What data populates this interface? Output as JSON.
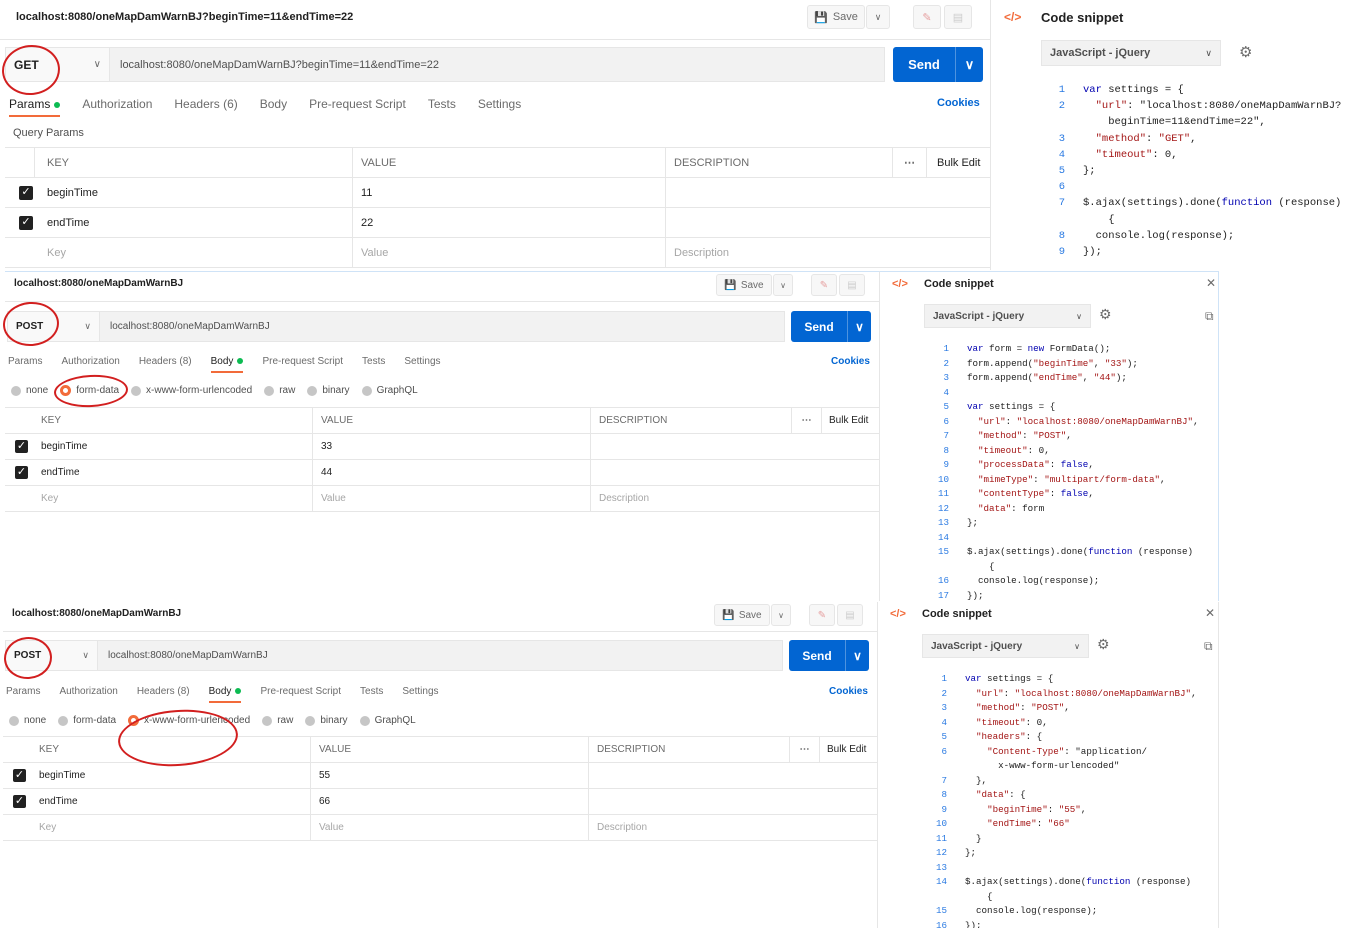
{
  "common": {
    "save_label": "Save",
    "send_label": "Send",
    "cookies_label": "Cookies",
    "bulk_edit_label": "Bulk Edit",
    "code_snippet_title": "Code snippet",
    "language": "JavaScript - jQuery",
    "col_key": "KEY",
    "col_value": "VALUE",
    "col_description": "DESCRIPTION",
    "ph_key": "Key",
    "ph_value": "Value",
    "ph_description": "Description",
    "query_params_label": "Query Params",
    "tabs": {
      "params": "Params",
      "authorization": "Authorization",
      "headers6": "Headers (6)",
      "headers8": "Headers (8)",
      "body": "Body",
      "prerequest": "Pre-request Script",
      "tests": "Tests",
      "settings": "Settings"
    },
    "body_types": [
      "none",
      "form-data",
      "x-www-form-urlencoded",
      "raw",
      "binary",
      "GraphQL"
    ]
  },
  "req1": {
    "title": "localhost:8080/oneMapDamWarnBJ?beginTime=11&endTime=22",
    "method": "GET",
    "url": "localhost:8080/oneMapDamWarnBJ?beginTime=11&endTime=22",
    "rows": [
      {
        "key": "beginTime",
        "value": "11"
      },
      {
        "key": "endTime",
        "value": "22"
      }
    ],
    "code": [
      [
        "1",
        "var settings = {"
      ],
      [
        "2",
        "  \"url\": \"localhost:8080/oneMapDamWarnBJ?"
      ],
      [
        "",
        "    beginTime=11&endTime=22\","
      ],
      [
        "3",
        "  \"method\": \"GET\","
      ],
      [
        "4",
        "  \"timeout\": 0,"
      ],
      [
        "5",
        "};"
      ],
      [
        "6",
        ""
      ],
      [
        "7",
        "$.ajax(settings).done(function (response)"
      ],
      [
        "",
        "    {"
      ],
      [
        "8",
        "  console.log(response);"
      ],
      [
        "9",
        "});"
      ]
    ]
  },
  "req2": {
    "title": "localhost:8080/oneMapDamWarnBJ",
    "method": "POST",
    "url": "localhost:8080/oneMapDamWarnBJ",
    "rows": [
      {
        "key": "beginTime",
        "value": "33"
      },
      {
        "key": "endTime",
        "value": "44"
      }
    ],
    "code": [
      [
        "1",
        "var form = new FormData();"
      ],
      [
        "2",
        "form.append(\"beginTime\", \"33\");"
      ],
      [
        "3",
        "form.append(\"endTime\", \"44\");"
      ],
      [
        "4",
        ""
      ],
      [
        "5",
        "var settings = {"
      ],
      [
        "6",
        "  \"url\": \"localhost:8080/oneMapDamWarnBJ\","
      ],
      [
        "7",
        "  \"method\": \"POST\","
      ],
      [
        "8",
        "  \"timeout\": 0,"
      ],
      [
        "9",
        "  \"processData\": false,"
      ],
      [
        "10",
        "  \"mimeType\": \"multipart/form-data\","
      ],
      [
        "11",
        "  \"contentType\": false,"
      ],
      [
        "12",
        "  \"data\": form"
      ],
      [
        "13",
        "};"
      ],
      [
        "14",
        ""
      ],
      [
        "15",
        "$.ajax(settings).done(function (response)"
      ],
      [
        "",
        "    {"
      ],
      [
        "16",
        "  console.log(response);"
      ],
      [
        "17",
        "});"
      ]
    ]
  },
  "req3": {
    "title": "localhost:8080/oneMapDamWarnBJ",
    "method": "POST",
    "url": "localhost:8080/oneMapDamWarnBJ",
    "rows": [
      {
        "key": "beginTime",
        "value": "55"
      },
      {
        "key": "endTime",
        "value": "66"
      }
    ],
    "code": [
      [
        "1",
        "var settings = {"
      ],
      [
        "2",
        "  \"url\": \"localhost:8080/oneMapDamWarnBJ\","
      ],
      [
        "3",
        "  \"method\": \"POST\","
      ],
      [
        "4",
        "  \"timeout\": 0,"
      ],
      [
        "5",
        "  \"headers\": {"
      ],
      [
        "6",
        "    \"Content-Type\": \"application/"
      ],
      [
        "",
        "      x-www-form-urlencoded\""
      ],
      [
        "7",
        "  },"
      ],
      [
        "8",
        "  \"data\": {"
      ],
      [
        "9",
        "    \"beginTime\": \"55\","
      ],
      [
        "10",
        "    \"endTime\": \"66\""
      ],
      [
        "11",
        "  }"
      ],
      [
        "12",
        "};"
      ],
      [
        "13",
        ""
      ],
      [
        "14",
        "$.ajax(settings).done(function (response)"
      ],
      [
        "",
        "    {"
      ],
      [
        "15",
        "  console.log(response);"
      ],
      [
        "16",
        "});"
      ]
    ]
  },
  "colors": {
    "accent": "#0265d2",
    "active_tab": "#f26b3a",
    "dot": "#0cbb52",
    "annotation": "#d21f1f"
  }
}
